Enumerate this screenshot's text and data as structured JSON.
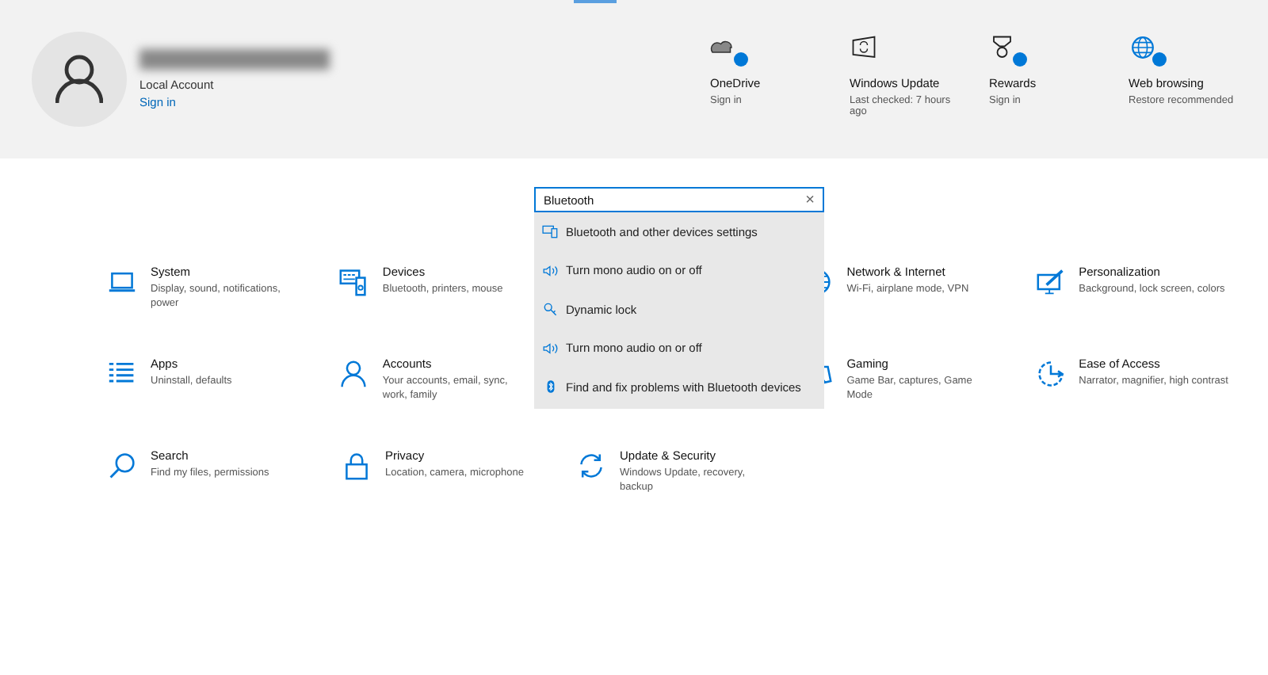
{
  "account": {
    "type": "Local Account",
    "link": "Sign in"
  },
  "quick_links": [
    {
      "title": "OneDrive",
      "sub": "Sign in",
      "badge": true
    },
    {
      "title": "Windows Update",
      "sub": "Last checked: 7 hours ago",
      "badge": false
    },
    {
      "title": "Rewards",
      "sub": "Sign in",
      "badge": true
    },
    {
      "title": "Web browsing",
      "sub": "Restore recommended",
      "badge": true
    }
  ],
  "search": {
    "value": "Bluetooth",
    "clear": "×",
    "results": [
      {
        "label": "Bluetooth and other devices settings"
      },
      {
        "label": "Turn mono audio on or off"
      },
      {
        "label": "Dynamic lock"
      },
      {
        "label": "Turn mono audio on or off"
      },
      {
        "label": "Find and fix problems with Bluetooth devices"
      }
    ]
  },
  "categories": [
    [
      {
        "title": "System",
        "desc": "Display, sound, notifications, power"
      },
      {
        "title": "Devices",
        "desc": "Bluetooth, printers, mouse"
      },
      {
        "title": "Network & Internet",
        "desc": "Wi-Fi, airplane mode, VPN"
      },
      {
        "title": "Personalization",
        "desc": "Background, lock screen, colors"
      }
    ],
    [
      {
        "title": "Apps",
        "desc": "Uninstall, defaults"
      },
      {
        "title": "Accounts",
        "desc": "Your accounts, email, sync, work, family"
      },
      {
        "title": "Gaming",
        "desc": "Game Bar, captures, Game Mode"
      },
      {
        "title": "Ease of Access",
        "desc": "Narrator, magnifier, high contrast"
      }
    ],
    [
      {
        "title": "Search",
        "desc": "Find my files, permissions"
      },
      {
        "title": "Privacy",
        "desc": "Location, camera, microphone"
      },
      {
        "title": "Update & Security",
        "desc": "Windows Update, recovery, backup"
      }
    ]
  ]
}
